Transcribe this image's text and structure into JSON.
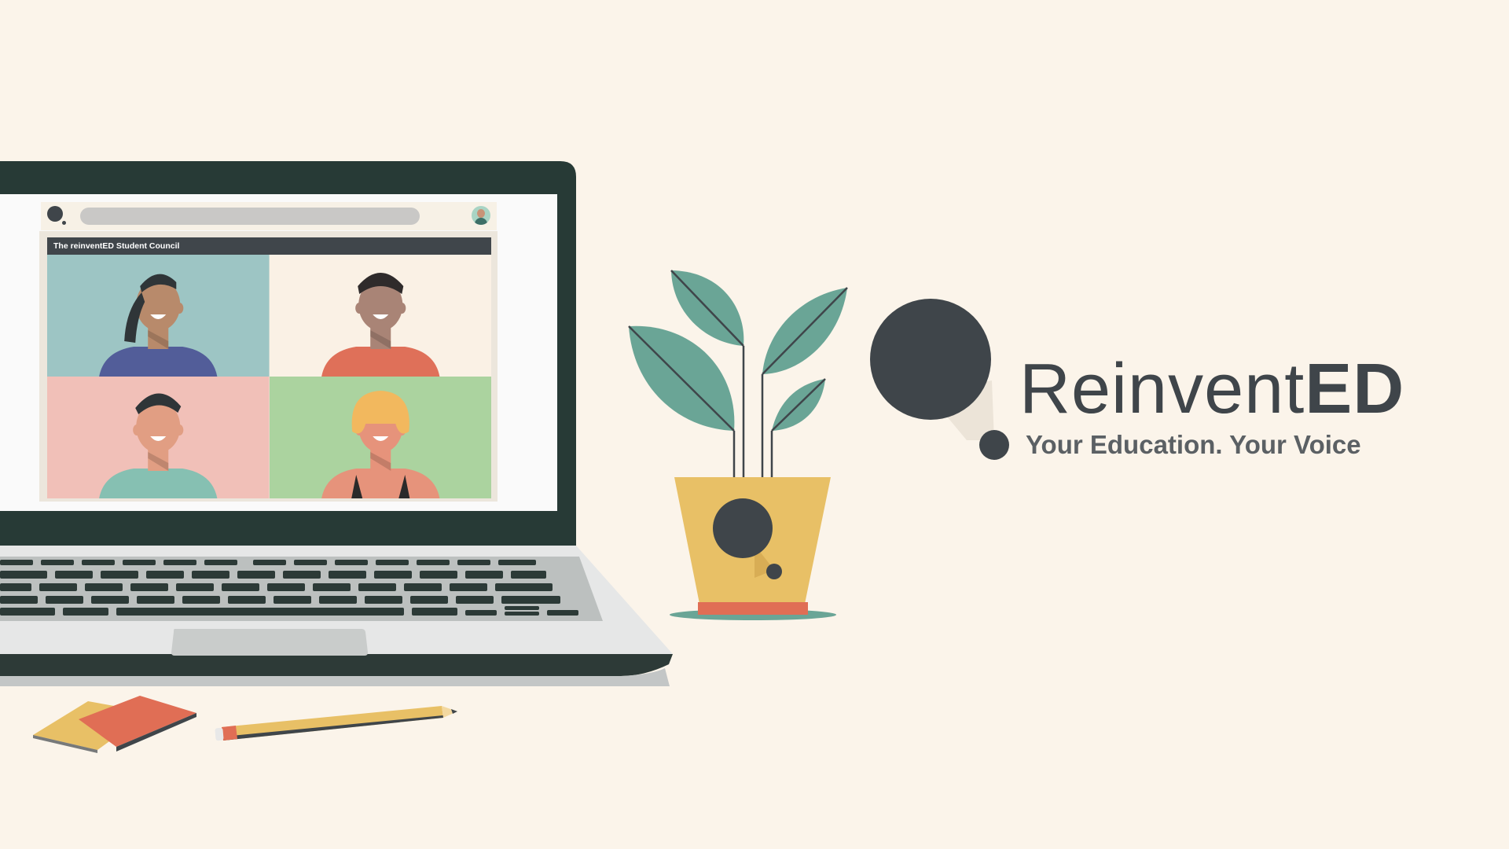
{
  "call": {
    "title": "The reinventED Student Council"
  },
  "participants": [
    {
      "name": "participant-1",
      "bg": "#9dc5c4",
      "skin": "#b88a6b",
      "hair": "#2f3538",
      "shirt": "#525d99"
    },
    {
      "name": "participant-2",
      "bg": "#faf1e5",
      "skin": "#a98476",
      "hair": "#2f2b2b",
      "shirt": "#df7059"
    },
    {
      "name": "participant-3",
      "bg": "#f1c0b8",
      "skin": "#e19e83",
      "hair": "#2f3538",
      "shirt": "#86c0b2"
    },
    {
      "name": "participant-4",
      "bg": "#abd39f",
      "skin": "#e6937b",
      "hair": "#f2b85e",
      "shirt": "#2a2a2a"
    }
  ],
  "brand": {
    "name_regular": "Reinvent",
    "name_bold": "ED",
    "tagline": "Your Education. Your Voice"
  },
  "colors": {
    "background": "#fbf4ea",
    "laptop_frame": "#273a36",
    "charcoal": "#3f454a",
    "leaf_green": "#6aa596",
    "pot_yellow": "#e8c066",
    "coral": "#e06e55"
  }
}
